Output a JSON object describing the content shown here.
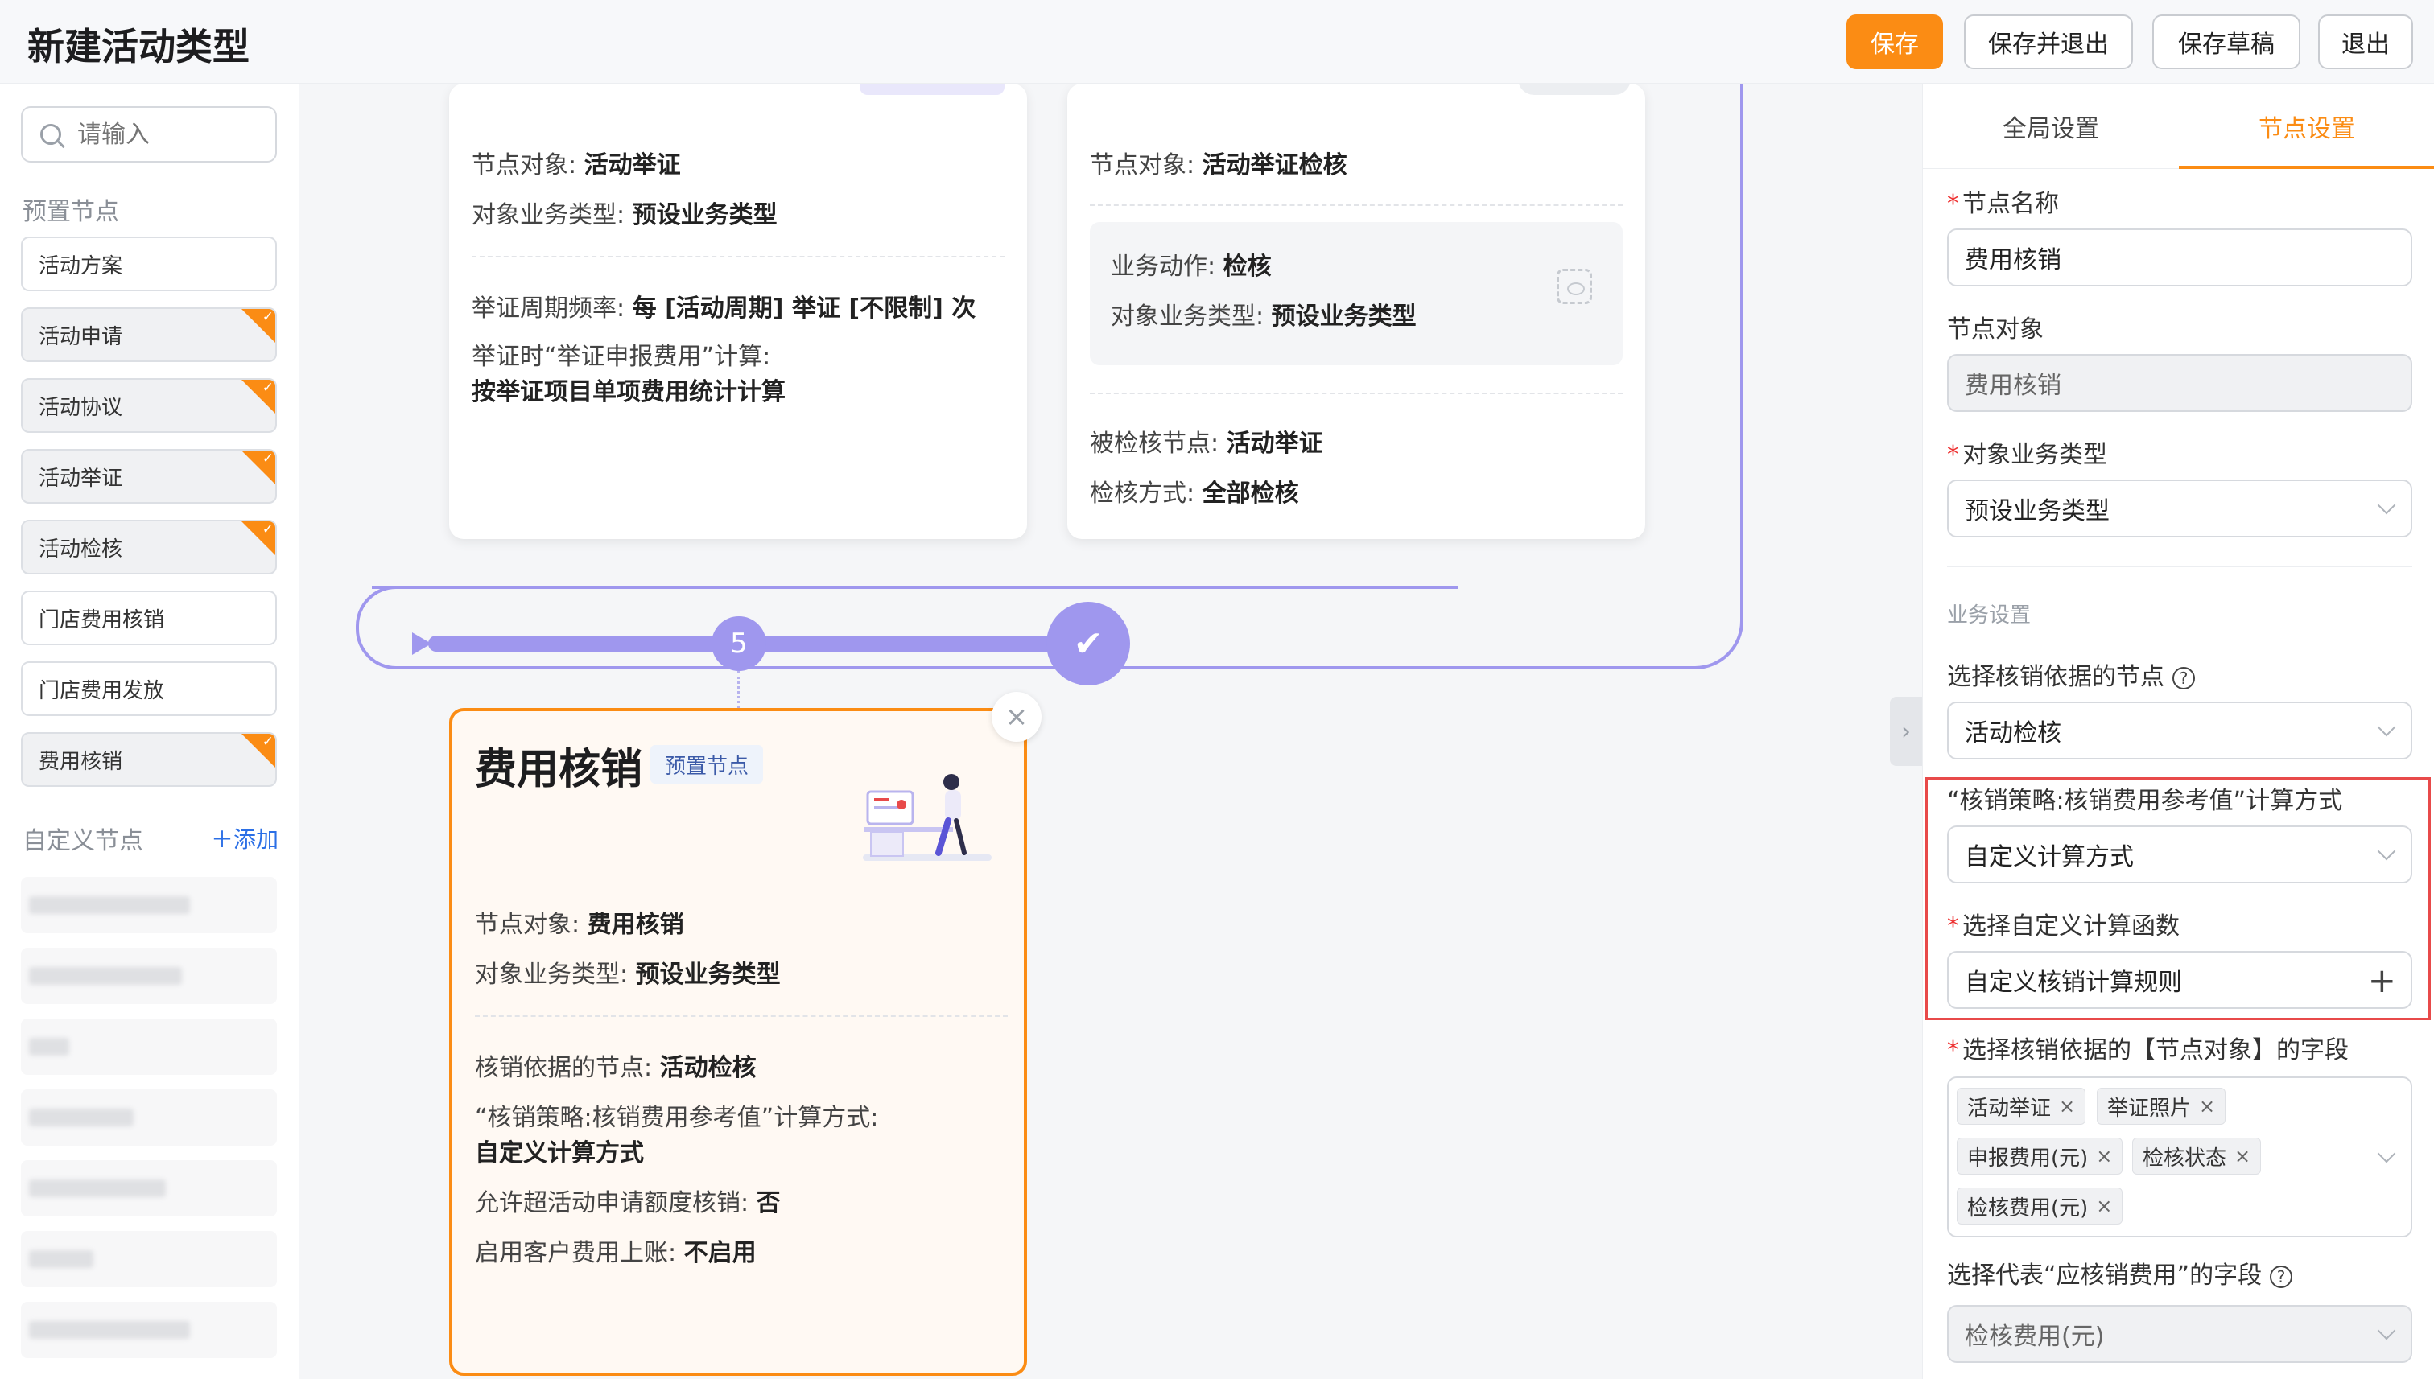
{
  "header": {
    "title": "新建活动类型",
    "buttons": {
      "save": "保存",
      "save_exit": "保存并退出",
      "save_draft": "保存草稿",
      "exit": "退出"
    }
  },
  "sidebar": {
    "search_placeholder": "请输入",
    "preset_label": "预置节点",
    "preset_items": [
      {
        "label": "活动方案",
        "flag": false
      },
      {
        "label": "活动申请",
        "flag": true
      },
      {
        "label": "活动协议",
        "flag": true
      },
      {
        "label": "活动举证",
        "flag": true
      },
      {
        "label": "活动检核",
        "flag": true
      },
      {
        "label": "门店费用核销",
        "flag": false
      },
      {
        "label": "门店费用发放",
        "flag": false
      },
      {
        "label": "费用核销",
        "flag": true
      }
    ],
    "custom_label": "自定义节点",
    "add_label": "＋添加"
  },
  "canvas": {
    "card1": {
      "rows": [
        {
          "k": "节点对象: ",
          "v": "活动举证"
        },
        {
          "k": "对象业务类型: ",
          "v": "预设业务类型"
        },
        {
          "k": "举证周期频率: ",
          "v": "每 [活动周期] 举证 [不限制] 次"
        },
        {
          "k": "举证时“举证申报费用”计算:",
          "v": ""
        },
        {
          "k": "",
          "v": "按举证项目单项费用统计计算"
        }
      ]
    },
    "card2": {
      "rows": [
        {
          "k": "节点对象: ",
          "v": "活动举证检核"
        },
        {
          "k": "业务动作: ",
          "v": "检核"
        },
        {
          "k": "对象业务类型: ",
          "v": "预设业务类型"
        },
        {
          "k": "被检核节点: ",
          "v": "活动举证"
        },
        {
          "k": "检核方式: ",
          "v": "全部检核"
        }
      ]
    },
    "step_number": "5",
    "step_done": "✔",
    "fee_card": {
      "title": "费用核销",
      "badge": "预置节点",
      "rows": [
        {
          "k": "节点对象: ",
          "v": "费用核销"
        },
        {
          "k": "对象业务类型: ",
          "v": "预设业务类型"
        },
        {
          "k": "核销依据的节点: ",
          "v": "活动检核"
        },
        {
          "k": "“核销策略:核销费用参考值”计算方式:",
          "v": ""
        },
        {
          "k": "",
          "v": "自定义计算方式"
        },
        {
          "k": "允许超活动申请额度核销: ",
          "v": "否"
        },
        {
          "k": "启用客户费用上账: ",
          "v": "不启用"
        }
      ]
    }
  },
  "panel": {
    "tabs": [
      "全局设置",
      "节点设置"
    ],
    "node_name_label": "节点名称",
    "node_name_value": "费用核销",
    "node_object_label": "节点对象",
    "node_object_value": "费用核销",
    "biz_type_label": "对象业务类型",
    "biz_type_value": "预设业务类型",
    "biz_settings_label": "业务设置",
    "basis_node_label": "选择核销依据的节点",
    "basis_node_value": "活动检核",
    "strategy_label": "“核销策略:核销费用参考值”计算方式",
    "strategy_value": "自定义计算方式",
    "func_label": "选择自定义计算函数",
    "func_value": "自定义核销计算规则",
    "fields_label": "选择核销依据的【节点对象】的字段",
    "field_tags": [
      "活动举证",
      "举证照片",
      "申报费用(元)",
      "检核状态",
      "检核费用(元)"
    ],
    "fee_field_label": "选择代表“应核销费用”的字段",
    "fee_field_value": "检核费用(元)"
  }
}
